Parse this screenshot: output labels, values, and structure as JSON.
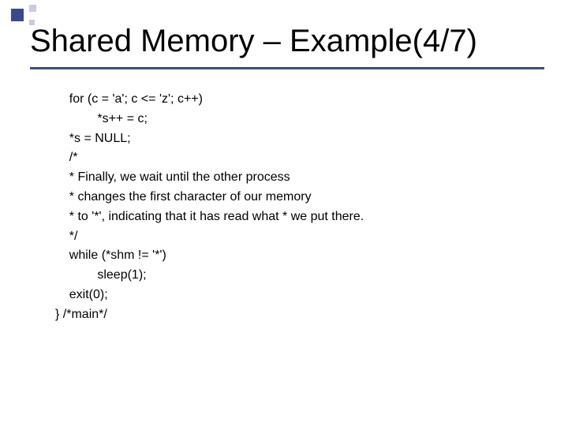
{
  "title": "Shared Memory – Example(4/7)",
  "code": {
    "l1": "    for (c = 'a'; c <= 'z'; c++)",
    "l2": "            *s++ = c;",
    "l3": "    *s = NULL;",
    "l4": "    /*",
    "l5": "    * Finally, we wait until the other process",
    "l6": "    * changes the first character of our memory",
    "l7": "    * to '*', indicating that it has read what * we put there.",
    "l8": "    */",
    "l9": "    while (*shm != '*')",
    "l10": "            sleep(1);",
    "l11": "    exit(0);",
    "l12": "} /*main*/"
  }
}
